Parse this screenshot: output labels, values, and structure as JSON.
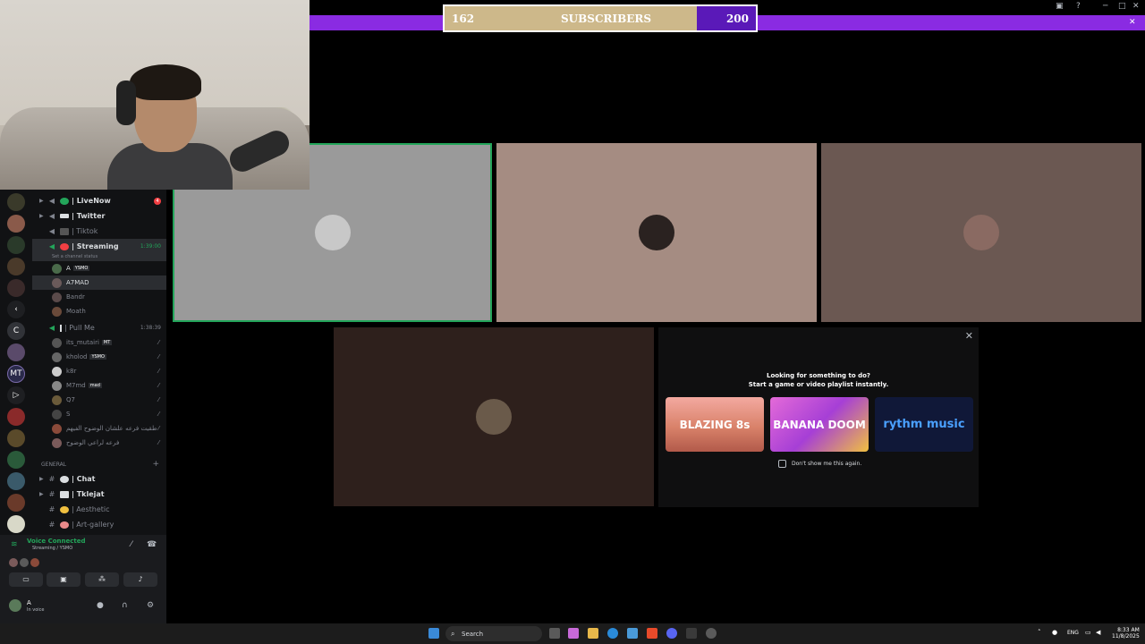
{
  "subscribers": {
    "current": "162",
    "label": "SUBSCRIBERS",
    "goal": "200",
    "progress": 0.81
  },
  "server_rail": {
    "items": [
      "C",
      "MT"
    ]
  },
  "channels": {
    "voice": [
      {
        "name": "| LiveNow",
        "badge": "4"
      },
      {
        "name": "| Twitter"
      },
      {
        "name": "| Tiktok"
      },
      {
        "name": "| Streaming",
        "time": "1:39:00",
        "status": "Set a channel status"
      }
    ],
    "streaming_users": [
      {
        "name": "A",
        "tag": "YSMO"
      },
      {
        "name": "A7MAD"
      },
      {
        "name": "Bandr"
      },
      {
        "name": "Moath"
      }
    ],
    "pull_me": {
      "name": "| Pull Me",
      "time": "1:38:39"
    },
    "pull_users": [
      {
        "name": "its_mutairi",
        "tag": "MT"
      },
      {
        "name": "kholod",
        "tag": "YSMO"
      },
      {
        "name": "k8r"
      },
      {
        "name": "M7md",
        "tag": "mad"
      },
      {
        "name": "Q7"
      },
      {
        "name": "S"
      },
      {
        "name": "طقيت فرعه علشان الوضوح الفيهم"
      },
      {
        "name": "فرعه لراعي الوضوح"
      }
    ],
    "category": "GENERAL",
    "text": [
      {
        "name": "| Chat"
      },
      {
        "name": "| Tklejat"
      },
      {
        "name": "| Aesthetic"
      },
      {
        "name": "| Art-gallery"
      }
    ]
  },
  "voice_panel": {
    "title": "Voice Connected",
    "subtitle": "Streaming / YSMO",
    "user": "A",
    "user_status": "In voice"
  },
  "activity": {
    "title": "Looking for something to do?",
    "subtitle": "Start a game or video playlist instantly.",
    "games": [
      "BLAZING 8s",
      "BANANA DOOM",
      "rythm music"
    ],
    "checkbox_label": "Don't show me this again."
  },
  "taskbar": {
    "search": "Search",
    "lang": "ENG",
    "time": "8:33 AM",
    "date": "11/8/2025"
  },
  "colors": {
    "accent": "#8a2be2",
    "gold": "#cdb88a",
    "online": "#23a55a",
    "alert": "#f23f43"
  }
}
